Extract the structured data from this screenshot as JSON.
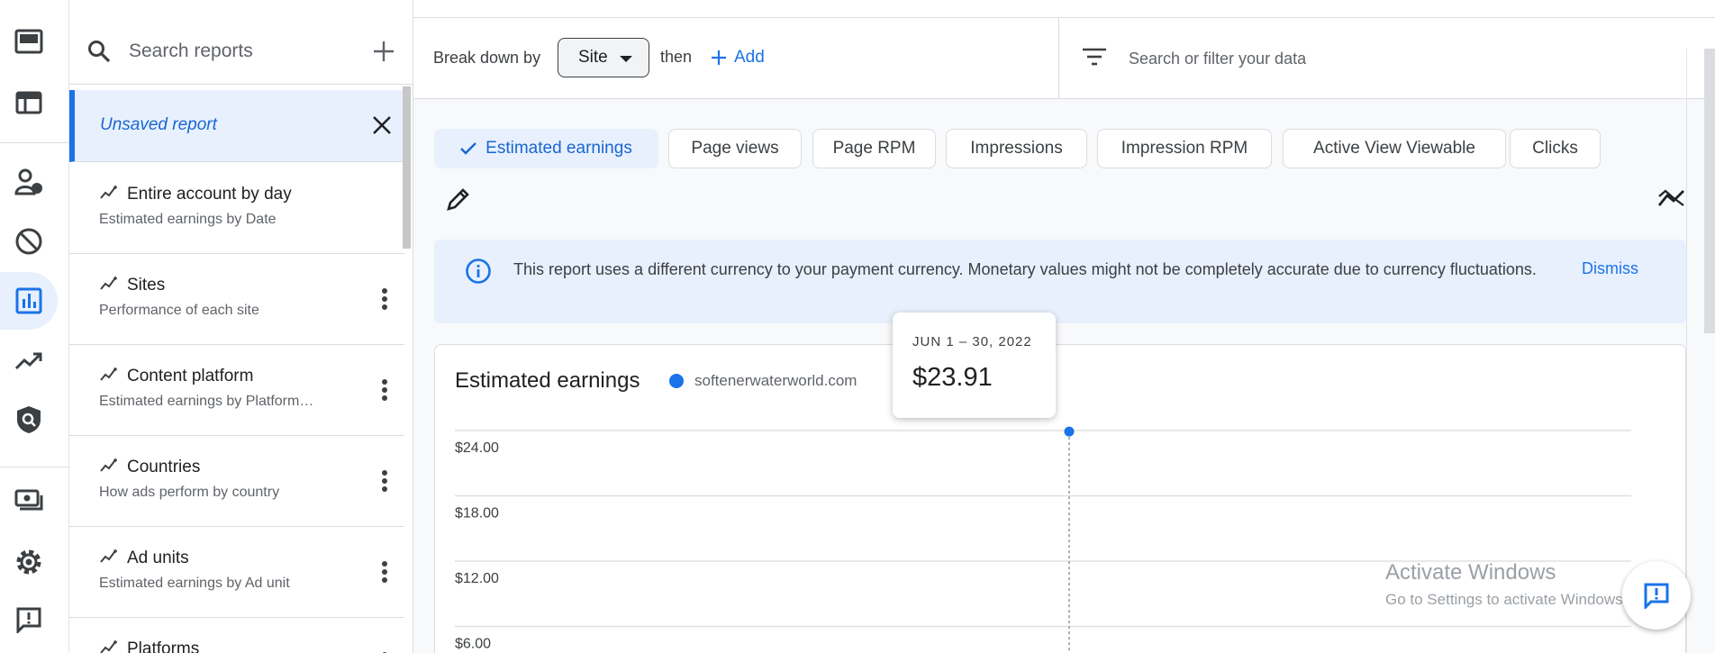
{
  "nav": {
    "items": [
      {
        "name": "overview-icon",
        "active": false
      },
      {
        "name": "layout-icon",
        "active": false
      },
      {
        "name": "account-icon",
        "active": false
      },
      {
        "name": "block-icon",
        "active": false
      },
      {
        "name": "reports-icon",
        "active": true
      },
      {
        "name": "trending-icon",
        "active": false
      },
      {
        "name": "policy-icon",
        "active": false
      },
      {
        "name": "payments-icon",
        "active": false
      },
      {
        "name": "settings-icon",
        "active": false
      },
      {
        "name": "feedback-icon",
        "active": false
      }
    ]
  },
  "report_list": {
    "search_placeholder": "Search reports",
    "unsaved": {
      "label": "Unsaved report"
    },
    "items": [
      {
        "title": "Entire account by day",
        "subtitle": "Estimated earnings by Date",
        "has_menu": false
      },
      {
        "title": "Sites",
        "subtitle": "Performance of each site",
        "has_menu": true
      },
      {
        "title": "Content platform",
        "subtitle": "Estimated earnings by Platform…",
        "has_menu": true
      },
      {
        "title": "Countries",
        "subtitle": "How ads perform by country",
        "has_menu": true
      },
      {
        "title": "Ad units",
        "subtitle": "Estimated earnings by Ad unit",
        "has_menu": true
      },
      {
        "title": "Platforms",
        "subtitle": "",
        "has_menu": true
      }
    ]
  },
  "breakdown": {
    "label": "Break down by",
    "selected": "Site",
    "then_label": "then",
    "add_label": "Add"
  },
  "filter": {
    "placeholder": "Search or filter your data"
  },
  "metrics": [
    {
      "label": "Estimated earnings",
      "selected": true
    },
    {
      "label": "Page views",
      "selected": false
    },
    {
      "label": "Page RPM",
      "selected": false
    },
    {
      "label": "Impressions",
      "selected": false
    },
    {
      "label": "Impression RPM",
      "selected": false
    },
    {
      "label": "Active View Viewable",
      "selected": false
    },
    {
      "label": "Clicks",
      "selected": false
    }
  ],
  "banner": {
    "text": "This report uses a different currency to your payment currency. Monetary values might not be completely accurate due to currency fluctuations.",
    "dismiss_label": "Dismiss"
  },
  "chart_data": {
    "type": "line",
    "title": "Estimated earnings",
    "series": [
      {
        "name": "softenerwaterworld.com",
        "color": "#1a73e8",
        "x": [
          "JUN 1 – 30, 2022"
        ],
        "values": [
          23.91
        ]
      }
    ],
    "y_ticks": [
      "$24.00",
      "$18.00",
      "$12.00",
      "$6.00"
    ],
    "y_tick_values": [
      24,
      18,
      12,
      6
    ],
    "grid": true
  },
  "tooltip": {
    "date": "JUN 1 – 30, 2022",
    "value": "$23.91"
  },
  "watermark": {
    "title": "Activate Windows",
    "subtitle": "Go to Settings to activate Windows."
  },
  "colors": {
    "accent": "#1a73e8",
    "selected_bg": "#e8f0fe",
    "text": "#202124",
    "muted": "#5f6368"
  }
}
